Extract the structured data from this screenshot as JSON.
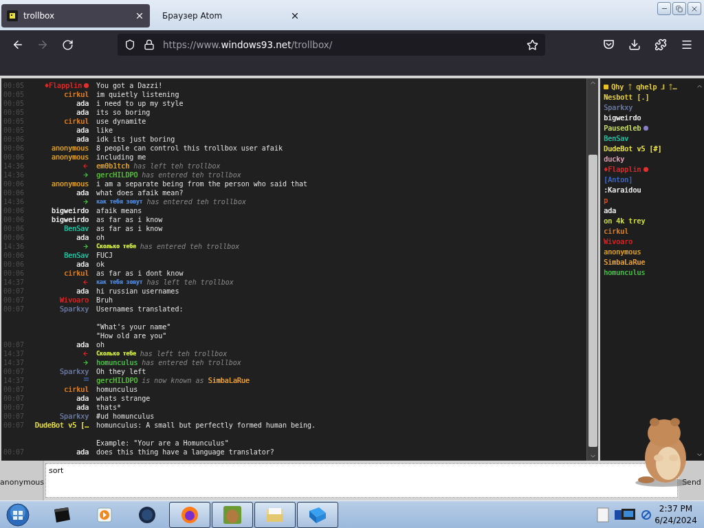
{
  "browser": {
    "tabs": [
      {
        "label": "trollbox",
        "selected": true
      },
      {
        "label": "Браузер Atom",
        "selected": false
      }
    ],
    "nav": {
      "back_disabled": false,
      "forward_disabled": true
    },
    "url": {
      "scheme": "https://www.",
      "domain": "windows93.net",
      "path": "/trollbox/"
    }
  },
  "chat": {
    "messages": [
      {
        "kind": "message",
        "time": "00:05",
        "name": "♦Flapplin",
        "color": "#e02828",
        "badge": {
          "color": "#e03030"
        },
        "text": "You got a Dazzi!"
      },
      {
        "kind": "message",
        "time": "00:05",
        "name": "cirkul",
        "color": "#e08020",
        "text": "im quietly listening"
      },
      {
        "kind": "message",
        "time": "00:05",
        "name": "ada",
        "color": "#e8e8e8",
        "text": "i need to up my style"
      },
      {
        "kind": "message",
        "time": "00:05",
        "name": "ada",
        "color": "#e8e8e8",
        "text": "its so boring"
      },
      {
        "kind": "message",
        "time": "00:05",
        "name": "cirkul",
        "color": "#e08020",
        "text": "use dynamite"
      },
      {
        "kind": "message",
        "time": "00:05",
        "name": "ada",
        "color": "#e8e8e8",
        "text": "like"
      },
      {
        "kind": "message",
        "time": "00:06",
        "name": "ada",
        "color": "#e8e8e8",
        "text": "idk its just boring"
      },
      {
        "kind": "message",
        "time": "00:06",
        "name": "anonymous",
        "color": "#e0a020",
        "text": "8 people can control this trollbox user afaik"
      },
      {
        "kind": "message",
        "time": "00:06",
        "name": "anonymous",
        "color": "#e0a020",
        "text": "including me"
      },
      {
        "kind": "leave",
        "time": "14:36",
        "name": "em0b1tch",
        "color": "#e0a020",
        "action": "has left teh trollbox"
      },
      {
        "kind": "join",
        "time": "14:36",
        "name": "gercHILDPO",
        "color": "#50c030",
        "action": "has entered teh trollbox"
      },
      {
        "kind": "message",
        "time": "00:06",
        "name": "anonymous",
        "color": "#e0a020",
        "text": "i am a separate being from the person who said that"
      },
      {
        "kind": "message",
        "time": "00:06",
        "name": "ada",
        "color": "#e8e8e8",
        "text": "what does afaik mean?"
      },
      {
        "kind": "join",
        "time": "14:36",
        "name": "как тебя зовут",
        "color": "#4a80d0",
        "action": "has entered teh trollbox"
      },
      {
        "kind": "message",
        "time": "00:06",
        "name": "bigweirdo",
        "color": "#f0f0f0",
        "text": "afaik means"
      },
      {
        "kind": "message",
        "time": "00:06",
        "name": "bigweirdo",
        "color": "#f0f0f0",
        "text": "as far as i know"
      },
      {
        "kind": "message",
        "time": "00:06",
        "name": "BenSav",
        "color": "#20c0a0",
        "text": "as far as i know"
      },
      {
        "kind": "message",
        "time": "00:06",
        "name": "ada",
        "color": "#e8e8e8",
        "text": "oh"
      },
      {
        "kind": "join",
        "time": "14:36",
        "name": "Сколько тебе",
        "color": "#c8e040",
        "action": "has entered teh trollbox"
      },
      {
        "kind": "message",
        "time": "00:06",
        "name": "BenSav",
        "color": "#20c0a0",
        "text": "FUCJ"
      },
      {
        "kind": "message",
        "time": "00:06",
        "name": "ada",
        "color": "#e8e8e8",
        "text": "ok"
      },
      {
        "kind": "message",
        "time": "00:06",
        "name": "cirkul",
        "color": "#e08020",
        "text": "as far as i dont know"
      },
      {
        "kind": "leave",
        "time": "14:37",
        "name": "как тебя зовут",
        "color": "#4a80d0",
        "action": "has left teh trollbox"
      },
      {
        "kind": "message",
        "time": "00:07",
        "name": "ada",
        "color": "#e8e8e8",
        "text": "hi russian usernames"
      },
      {
        "kind": "message",
        "time": "00:07",
        "name": "Wivoaro",
        "color": "#e02020",
        "text": "Bruh"
      },
      {
        "kind": "message",
        "time": "00:07",
        "name": "Sparkxy",
        "color": "#6a78a0",
        "text": "Usernames translated:\n\n\"What's your name\"\n\"How old are you\""
      },
      {
        "kind": "message",
        "time": "00:07",
        "name": "ada",
        "color": "#e8e8e8",
        "text": "oh"
      },
      {
        "kind": "leave",
        "time": "14:37",
        "name": "Сколько тебе",
        "color": "#c8e040",
        "action": "has left teh trollbox"
      },
      {
        "kind": "join",
        "time": "14:37",
        "name": "homunculus",
        "color": "#40c040",
        "action": "has entered teh trollbox"
      },
      {
        "kind": "message",
        "time": "00:07",
        "name": "Sparkxy",
        "color": "#6a78a0",
        "text": "Oh they left"
      },
      {
        "kind": "rename",
        "time": "14:37",
        "name": "gercHILDPO",
        "color": "#50c030",
        "action": "is now known as",
        "target": {
          "name": "SimbaLaRue",
          "color": "#f0a030"
        }
      },
      {
        "kind": "message",
        "time": "00:07",
        "name": "cirkul",
        "color": "#e08020",
        "text": "homunculus"
      },
      {
        "kind": "message",
        "time": "00:07",
        "name": "ada",
        "color": "#e8e8e8",
        "text": "whats strange"
      },
      {
        "kind": "message",
        "time": "00:07",
        "name": "ada",
        "color": "#e8e8e8",
        "text": "thats*"
      },
      {
        "kind": "message",
        "time": "00:07",
        "name": "Sparkxy",
        "color": "#6a78a0",
        "text": "#ud homunculus"
      },
      {
        "kind": "message",
        "time": "00:07",
        "name": "DudeBot v5 […",
        "color": "#e8e040",
        "text": "homunculus: A small but perfectly formed human being.\n\nExample: \"Your are a Homunculus\""
      },
      {
        "kind": "message",
        "time": "00:07",
        "name": "ada",
        "color": "#e8e8e8",
        "text": "does this thing have a language translator?"
      }
    ]
  },
  "users": [
    {
      "name": "Qhy ᛏ qhelp ⅃ ᛏ…",
      "color": "#e8d040",
      "badge": {
        "color": "#e8c020"
      }
    },
    {
      "name": "Nesbott [.]",
      "color": "#e8d040"
    },
    {
      "name": "Sparkxy",
      "color": "#6a78a0"
    },
    {
      "name": "bigweirdo",
      "color": "#f0f0f0"
    },
    {
      "name": "Pausedleb",
      "color": "#c8e05a",
      "badge": {
        "color": "#8a80c8"
      }
    },
    {
      "name": "BenSav",
      "color": "#20c0a0"
    },
    {
      "name": "DudeBot v5 [#]",
      "color": "#e8e040"
    },
    {
      "name": "ducky",
      "color": "#e0a0b0"
    },
    {
      "name": "♦Flapplin",
      "color": "#e02828",
      "badge": {
        "color": "#e03030"
      }
    },
    {
      "name": "[Anton]",
      "color": "#3868c8"
    },
    {
      "name": ":Karaidou",
      "color": "#f0f0f0"
    },
    {
      "name": "p",
      "color": "#e05010"
    },
    {
      "name": "ada",
      "color": "#f0f0f0"
    },
    {
      "name": "on 4k trey",
      "color": "#d0e040"
    },
    {
      "name": "cirkul",
      "color": "#e08020"
    },
    {
      "name": "Wivoaro",
      "color": "#e02020"
    },
    {
      "name": "anonymous",
      "color": "#e0a020"
    },
    {
      "name": "SimbaLaRue",
      "color": "#f0a030"
    },
    {
      "name": "homunculus",
      "color": "#40c040"
    }
  ],
  "composer": {
    "nickname": "anonymous",
    "value": "sort",
    "send": "Send"
  },
  "taskbar": {
    "apps": [
      {
        "open": false
      },
      {
        "open": false
      },
      {
        "open": false
      },
      {
        "open": true
      },
      {
        "open": true
      },
      {
        "open": true
      },
      {
        "open": true
      }
    ],
    "time": "2:37 PM",
    "date": "6/24/2024"
  }
}
